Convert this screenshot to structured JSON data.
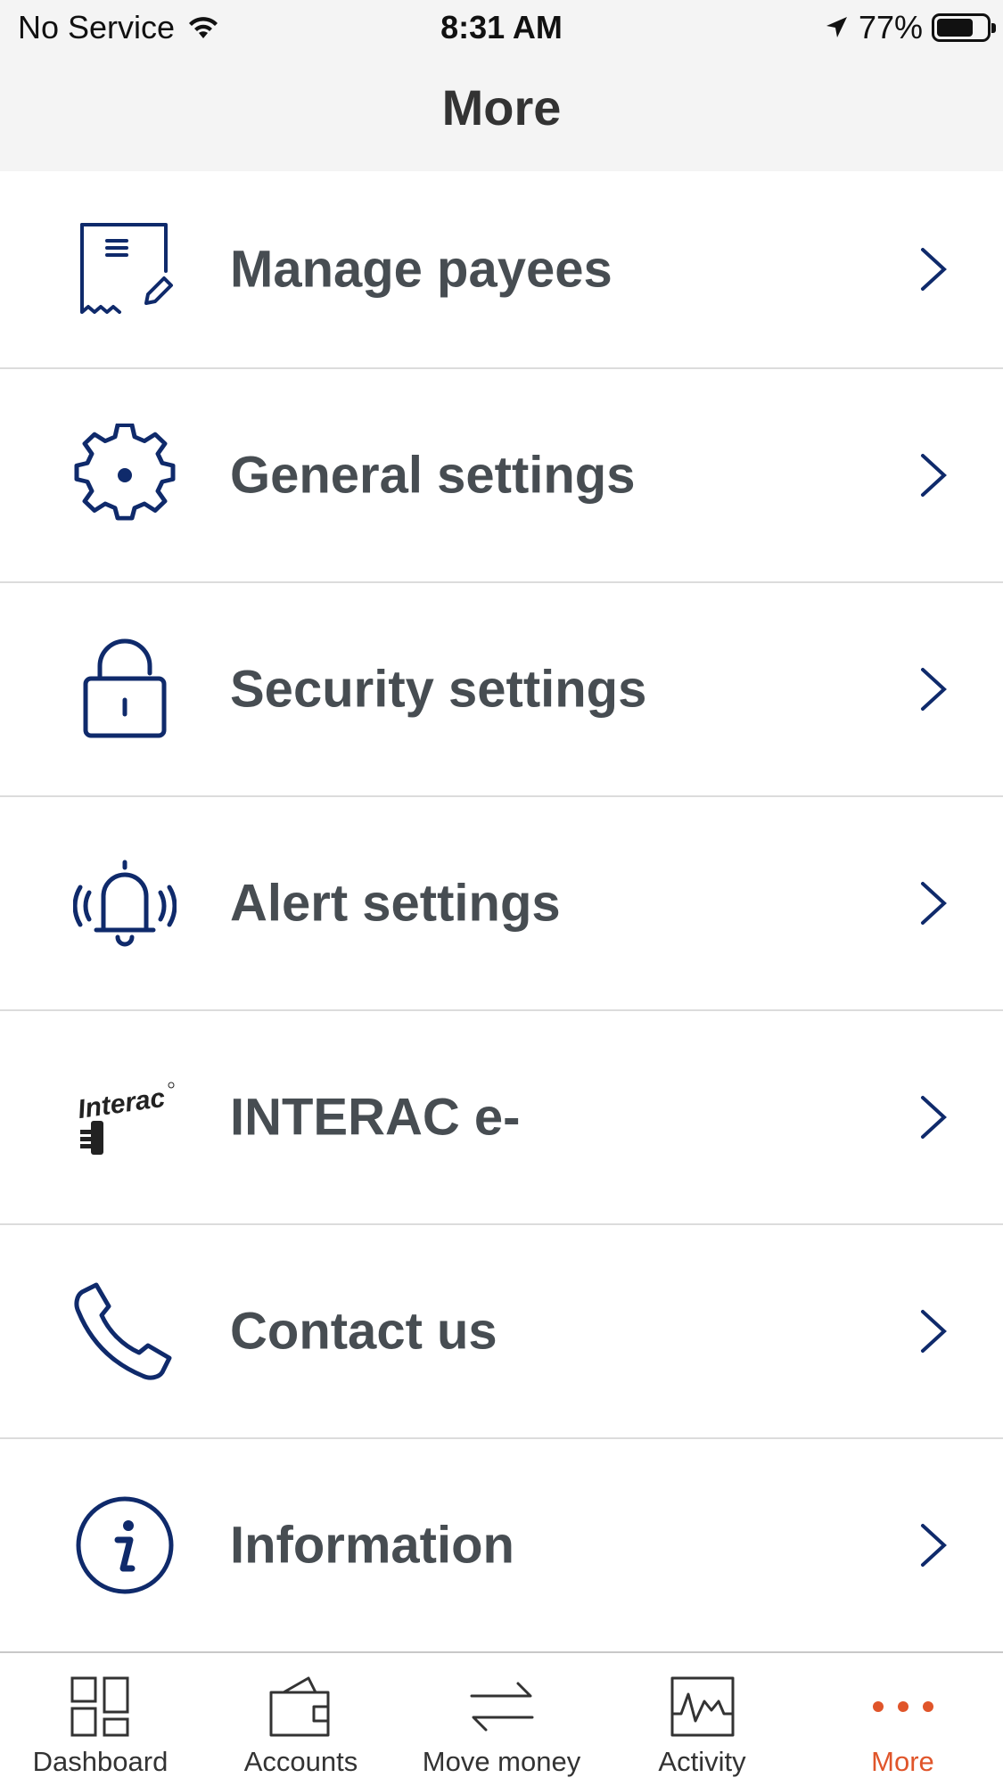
{
  "status_bar": {
    "carrier": "No Service",
    "time": "8:31 AM",
    "battery": "77%",
    "battery_level": 0.77
  },
  "header": {
    "title": "More"
  },
  "menu": {
    "items": [
      {
        "label": "Manage payees",
        "icon": "payee-receipt-icon"
      },
      {
        "label": "General settings",
        "icon": "gear-icon"
      },
      {
        "label": "Security settings",
        "icon": "lock-icon"
      },
      {
        "label": "Alert settings",
        "icon": "bell-icon"
      },
      {
        "label": "INTERAC e-",
        "icon": "interac-logo",
        "icon_text": "Interac"
      },
      {
        "label": "Contact us",
        "icon": "phone-icon"
      },
      {
        "label": "Information",
        "icon": "info-icon"
      }
    ]
  },
  "tab_bar": {
    "tabs": [
      {
        "label": "Dashboard",
        "icon": "dashboard-icon"
      },
      {
        "label": "Accounts",
        "icon": "wallet-icon"
      },
      {
        "label": "Move money",
        "icon": "transfer-arrows-icon"
      },
      {
        "label": "Activity",
        "icon": "activity-chart-icon"
      },
      {
        "label": "More",
        "icon": "more-dots-icon"
      }
    ],
    "active_tab": "More"
  },
  "colors": {
    "icon_navy": "#0f2a6b",
    "active_orange": "#e0552a",
    "label_gray": "#474d52",
    "header_bg": "#f4f4f4"
  }
}
